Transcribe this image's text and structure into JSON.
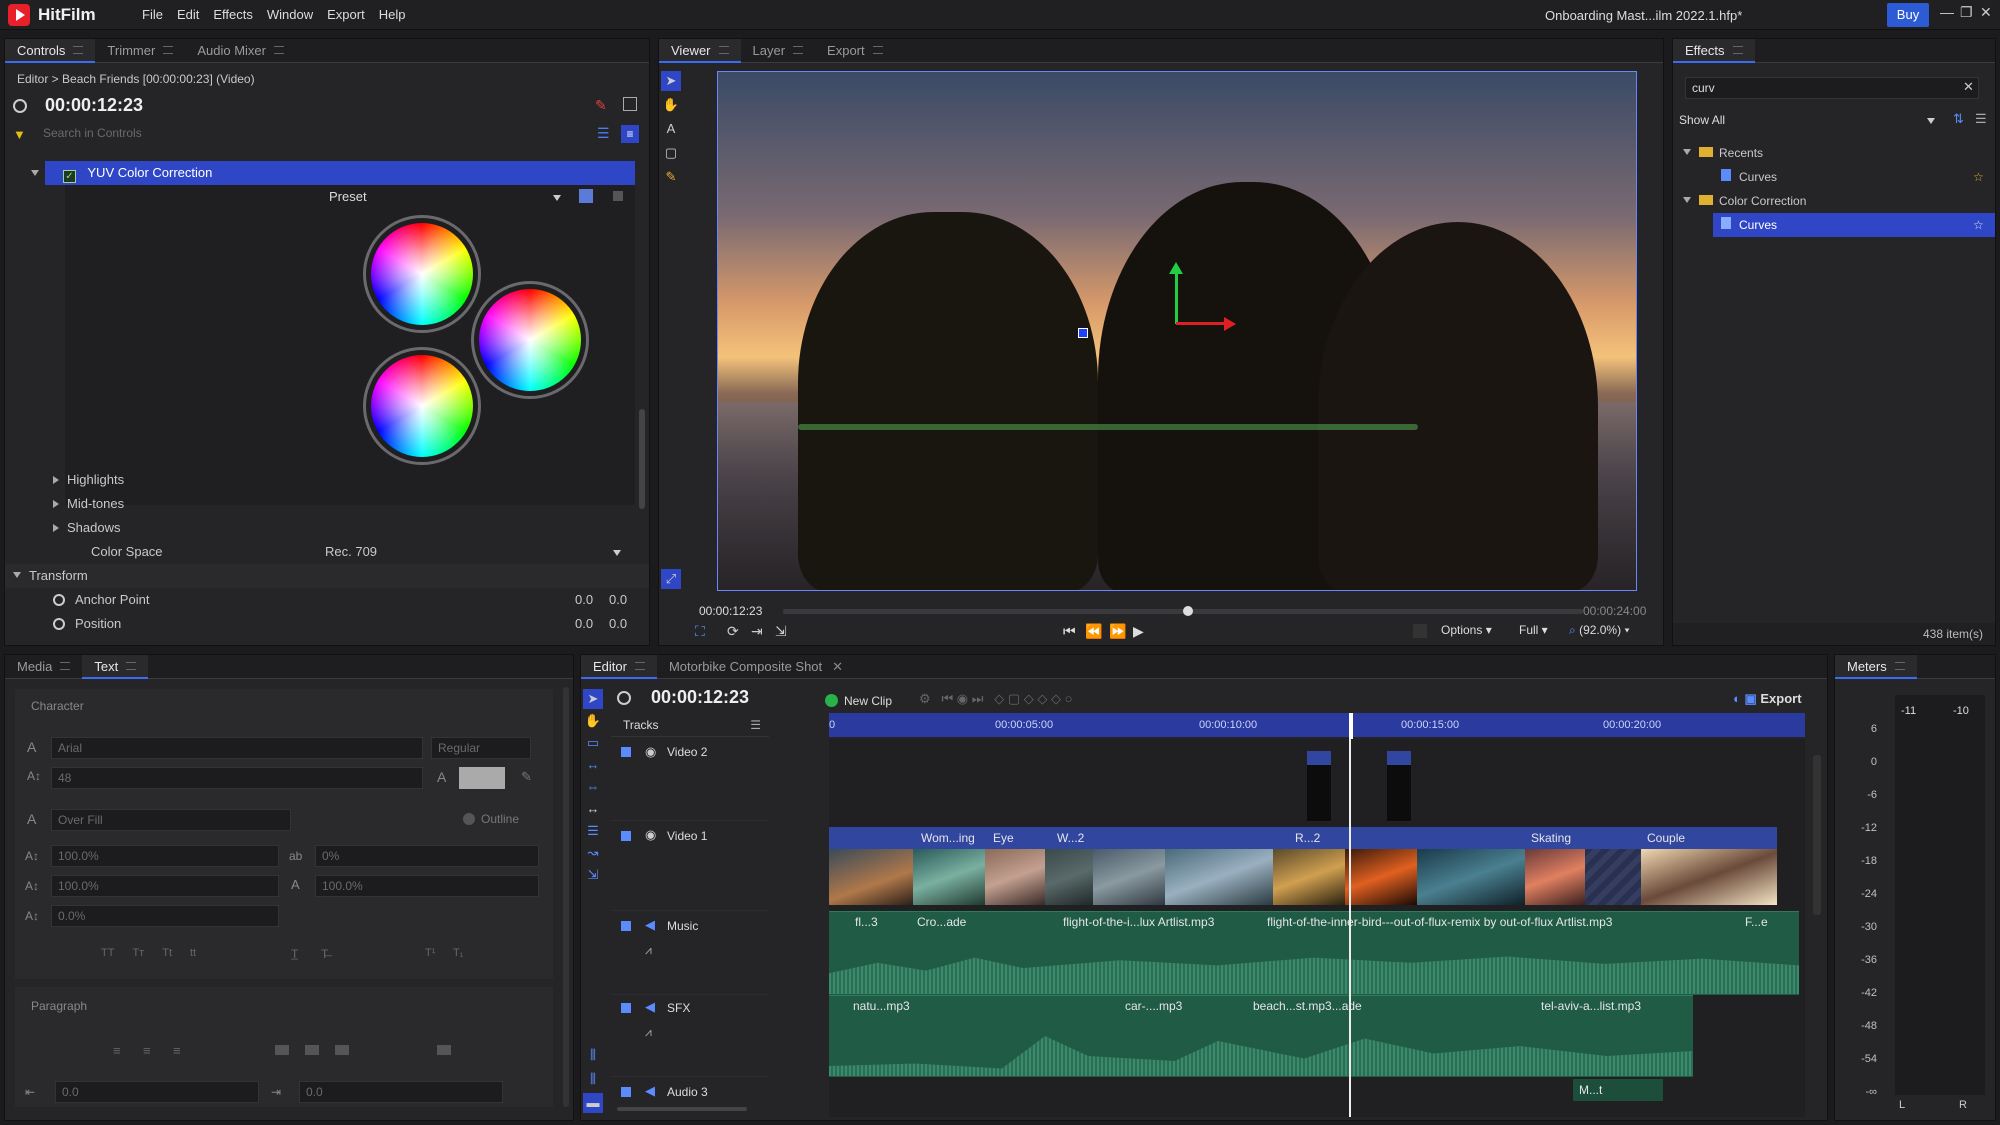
{
  "app": {
    "name": "HitFilm",
    "doc_title": "Onboarding Mast...ilm 2022.1.hfp*",
    "buy_label": "Buy"
  },
  "menu": [
    "File",
    "Edit",
    "Effects",
    "Window",
    "Export",
    "Help"
  ],
  "controls_panel": {
    "tabs": [
      "Controls",
      "Trimmer",
      "Audio Mixer"
    ],
    "breadcrumb": "Editor > Beach Friends [00:00:00:23] (Video)",
    "timecode": "00:00:12:23",
    "search_placeholder": "Search in Controls",
    "effect_name": "YUV Color Correction",
    "preset_label": "Preset",
    "groups": [
      "Highlights",
      "Mid-tones",
      "Shadows"
    ],
    "color_space_label": "Color Space",
    "color_space_value": "Rec. 709",
    "transform_label": "Transform",
    "props": [
      {
        "name": "Anchor Point",
        "x": "0.0",
        "y": "0.0"
      },
      {
        "name": "Position",
        "x": "0.0",
        "y": "0.0"
      }
    ]
  },
  "viewer_panel": {
    "tabs": [
      "Viewer",
      "Layer",
      "Export"
    ],
    "current_time": "00:00:12:23",
    "end_time": "00:00:24:00",
    "playhead_fraction": 0.5,
    "options_label": "Options",
    "quality_label": "Full",
    "zoom_label": "(92.0%)"
  },
  "effects_panel": {
    "tab": "Effects",
    "search_value": "curv",
    "filter_label": "Show All",
    "tree": [
      {
        "label": "Recents",
        "type": "folder",
        "child": "Curves"
      },
      {
        "label": "Color Correction",
        "type": "folder",
        "child": "Curves"
      }
    ],
    "count_label": "438 item(s)"
  },
  "text_panel": {
    "tabs": [
      "Media",
      "Text"
    ],
    "character_label": "Character",
    "font_value": "Arial",
    "style_value": "Regular",
    "size_value": "48",
    "fill_value": "Over Fill",
    "outline_label": "Outline",
    "scale_h": "100.0%",
    "scale_v": "100.0%",
    "tracking": "0%",
    "scale_other": "100.0%",
    "baseline": "0.0%",
    "case_buttons": [
      "TT",
      "Tт",
      "Tt",
      "tt"
    ],
    "paragraph_label": "Paragraph",
    "indent_left": "0.0",
    "indent_right": "0.0"
  },
  "editor_panel": {
    "tabs": [
      "Editor",
      "Motorbike Composite Shot"
    ],
    "timecode": "00:00:12:23",
    "new_clip_label": "New Clip",
    "export_label": "Export",
    "tracks_label": "Tracks",
    "ruler_ticks": [
      "0",
      "00:00:05:00",
      "00:00:10:00",
      "00:00:15:00",
      "00:00:20:00"
    ],
    "tracks": [
      {
        "name": "Video 2",
        "kind": "video"
      },
      {
        "name": "Video 1",
        "kind": "video"
      },
      {
        "name": "Music",
        "kind": "audio"
      },
      {
        "name": "SFX",
        "kind": "audio"
      },
      {
        "name": "Audio 3",
        "kind": "audio"
      }
    ],
    "video1_clip_labels": [
      "Wom...ing",
      "Eye",
      "W...2",
      "R...2",
      "Skating",
      "Couple"
    ],
    "music_clip_labels": [
      "fl...3",
      "Cro...ade",
      "flight-of-the-i...lux Artlist.mp3",
      "flight-of-the-inner-bird---out-of-flux-remix by out-of-flux Artlist.mp3",
      "F...e"
    ],
    "sfx_clip_labels": [
      "natu...mp3",
      "car-....mp3",
      "beach...st.mp3...ade",
      "tel-aviv-a...list.mp3"
    ],
    "audio3_clip_labels": [
      "M...t"
    ]
  },
  "meters_panel": {
    "tab": "Meters",
    "top_labels": [
      "-11",
      "-10"
    ],
    "scale": [
      "6",
      "0",
      "-6",
      "-12",
      "-18",
      "-24",
      "-30",
      "-36",
      "-42",
      "-48",
      "-54",
      "-∞"
    ],
    "channels": [
      "L",
      "R"
    ]
  }
}
